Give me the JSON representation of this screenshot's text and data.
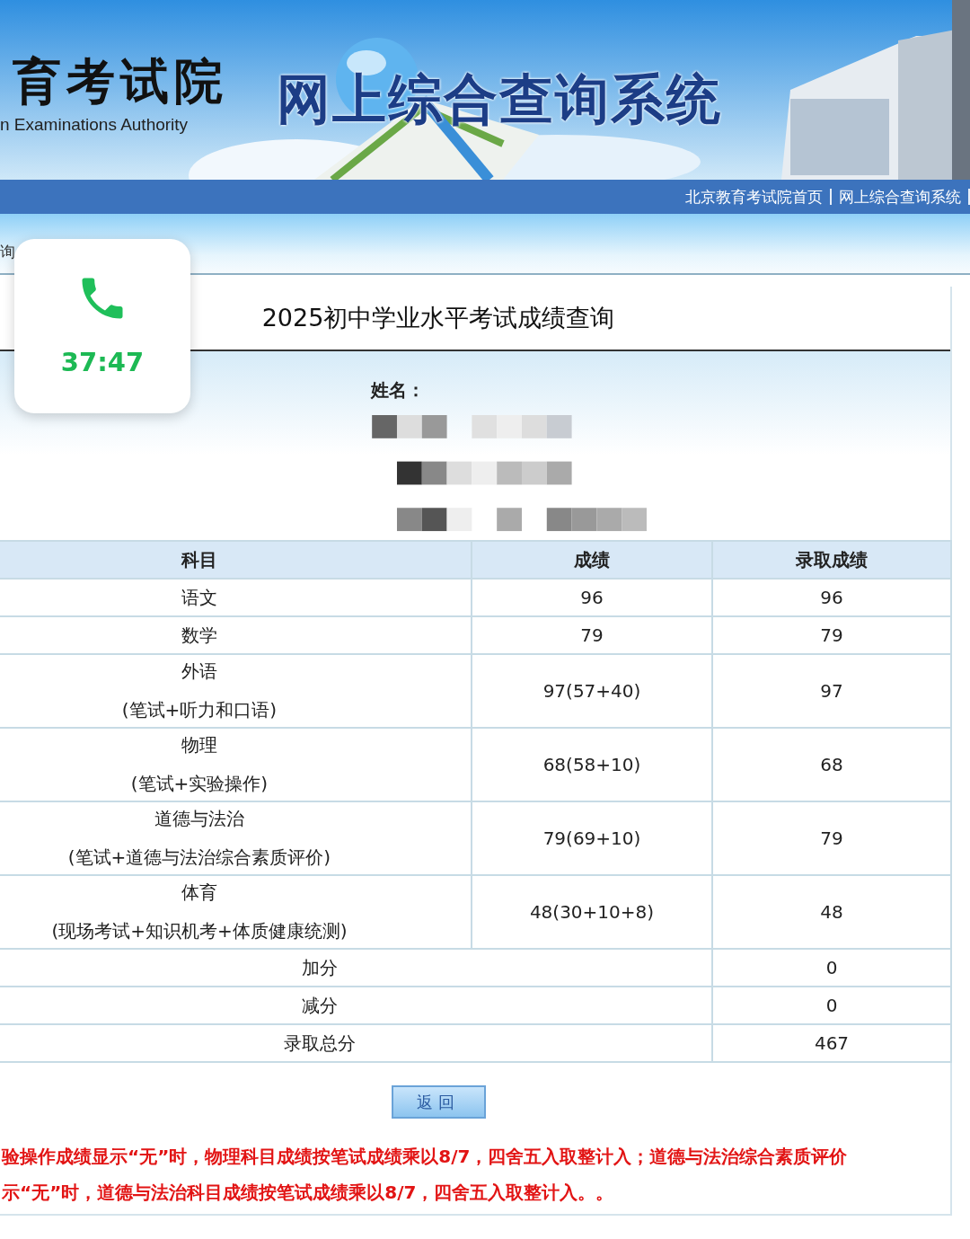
{
  "header": {
    "logo_cn": "育考试院",
    "logo_en": "n Examinations Authority",
    "system_title": "网上综合查询系统"
  },
  "nav": {
    "links": [
      "北京教育考试院首页",
      "网上综合查询系统"
    ]
  },
  "breadcrumb": "询",
  "call_overlay": {
    "duration": "37:47"
  },
  "result": {
    "title": "2025初中学业水平考试成绩查询",
    "name_label": "姓名：",
    "table": {
      "columns": [
        "科目",
        "成绩",
        "录取成绩"
      ],
      "rows": [
        {
          "subject": "语文",
          "score": "96",
          "admitted_score": "96"
        },
        {
          "subject": "数学",
          "score": "79",
          "admitted_score": "79"
        },
        {
          "subject": "外语",
          "note": "(笔试+听力和口语)",
          "score": "97(57+40)",
          "admitted_score": "97"
        },
        {
          "subject": "物理",
          "note": "(笔试+实验操作)",
          "score": "68(58+10)",
          "admitted_score": "68"
        },
        {
          "subject": "道德与法治",
          "note": "(笔试+道德与法治综合素质评价)",
          "score": "79(69+10)",
          "admitted_score": "79"
        },
        {
          "subject": "体育",
          "note": "(现场考试+知识机考+体质健康统测)",
          "score": "48(30+10+8)",
          "admitted_score": "48"
        }
      ],
      "summary_rows": [
        {
          "label": "加分",
          "value": "0"
        },
        {
          "label": "减分",
          "value": "0"
        },
        {
          "label": "录取总分",
          "value": "467"
        }
      ]
    },
    "return_button": "返回",
    "notes": [
      "验操作成绩显示“无”时，物理科目成绩按笔试成绩乘以8/7，四舍五入取整计入；道德与法治综合素质评价",
      "示“无”时，道德与法治科目成绩按笔试成绩乘以8/7，四舍五入取整计入。。"
    ]
  }
}
